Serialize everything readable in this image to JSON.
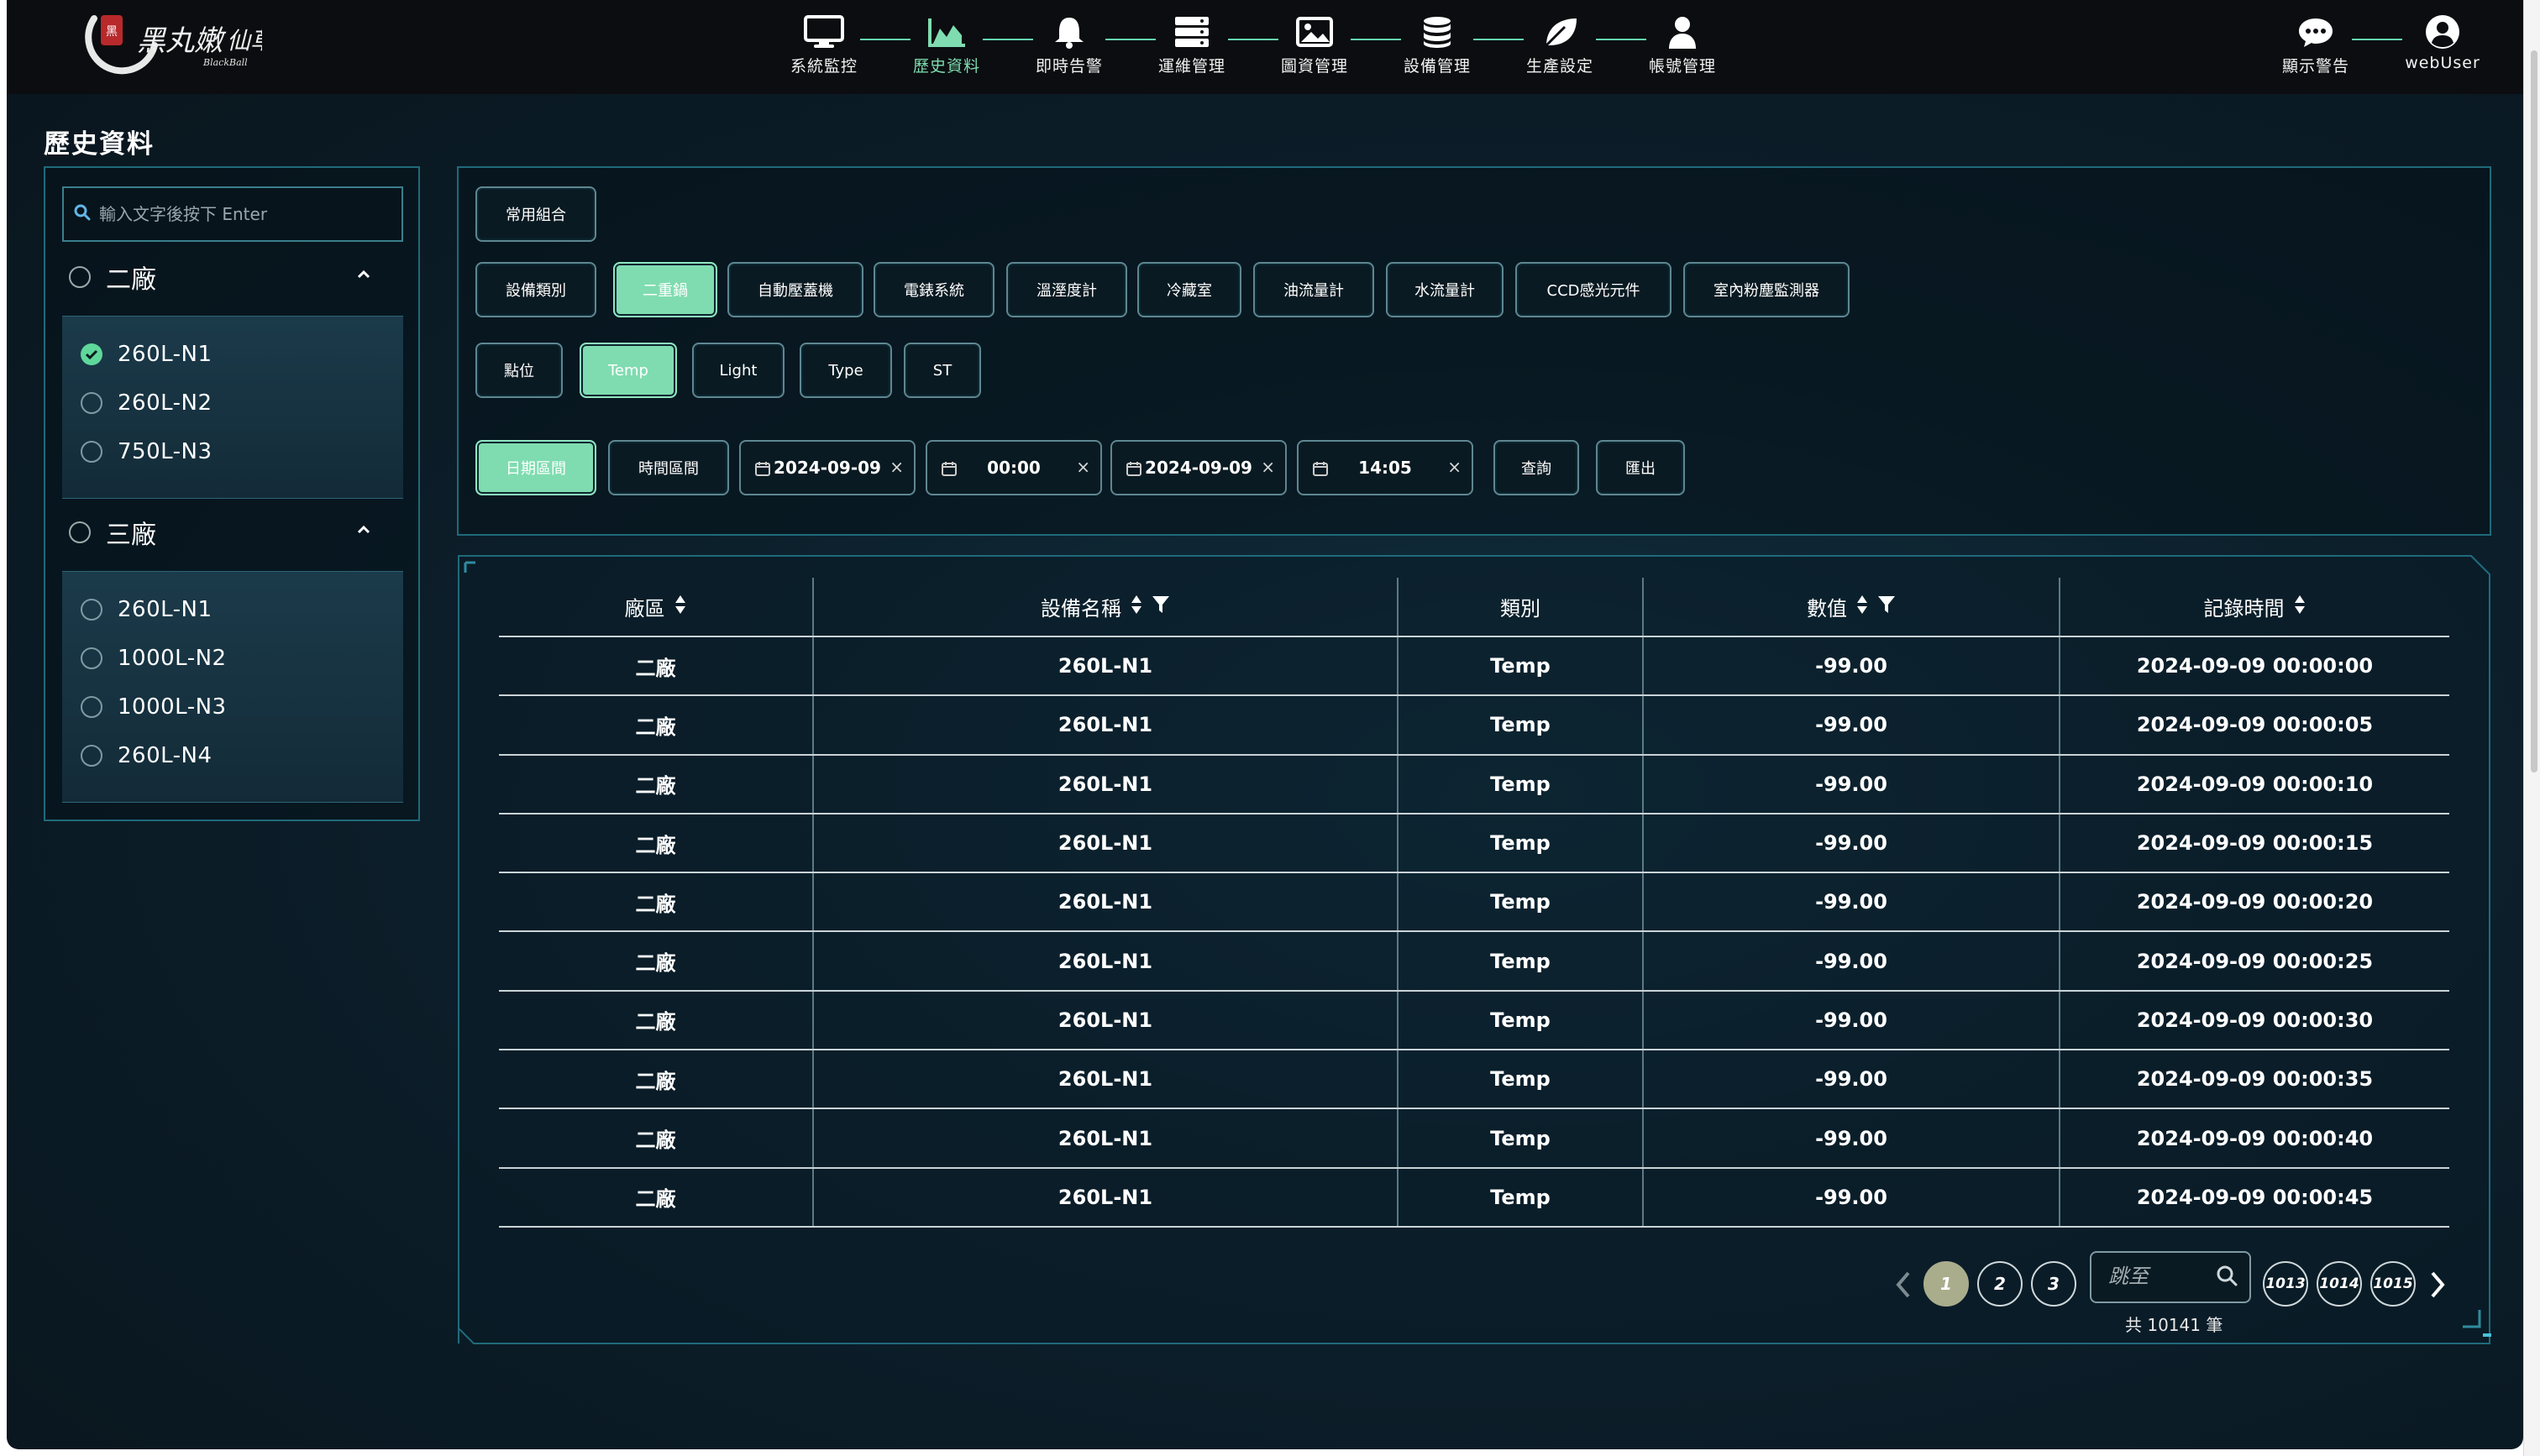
{
  "nav": {
    "items": [
      {
        "label": "系統監控",
        "icon": "monitor-icon",
        "active": false
      },
      {
        "label": "歷史資料",
        "icon": "area-chart-icon",
        "active": true
      },
      {
        "label": "即時告警",
        "icon": "bell-icon",
        "active": false
      },
      {
        "label": "運維管理",
        "icon": "server-icon",
        "active": false
      },
      {
        "label": "圖資管理",
        "icon": "image-icon",
        "active": false
      },
      {
        "label": "設備管理",
        "icon": "database-icon",
        "active": false
      },
      {
        "label": "生產設定",
        "icon": "leaf-icon",
        "active": false
      },
      {
        "label": "帳號管理",
        "icon": "user-icon",
        "active": false
      }
    ],
    "alert_label": "顯示警告",
    "user_label": "webUser",
    "accent": "#7fdcb0"
  },
  "page": {
    "title": "歷史資料"
  },
  "sidebar": {
    "search_placeholder": "輸入文字後按下 Enter",
    "groups": [
      {
        "name": "二廠",
        "expanded": true,
        "items": [
          {
            "label": "260L-N1",
            "checked": true
          },
          {
            "label": "260L-N2",
            "checked": false
          },
          {
            "label": "750L-N3",
            "checked": false
          }
        ]
      },
      {
        "name": "三廠",
        "expanded": true,
        "items": [
          {
            "label": "260L-N1",
            "checked": false
          },
          {
            "label": "1000L-N2",
            "checked": false
          },
          {
            "label": "1000L-N3",
            "checked": false
          },
          {
            "label": "260L-N4",
            "checked": false
          }
        ]
      }
    ]
  },
  "filters": {
    "common_combo_label": "常用組合",
    "device_type_label": "設備類別",
    "device_types": [
      {
        "label": "二重鍋",
        "active": true
      },
      {
        "label": "自動壓蓋機",
        "active": false
      },
      {
        "label": "電錶系統",
        "active": false
      },
      {
        "label": "溫溼度計",
        "active": false
      },
      {
        "label": "冷藏室",
        "active": false
      },
      {
        "label": "油流量計",
        "active": false
      },
      {
        "label": "水流量計",
        "active": false
      },
      {
        "label": "CCD感光元件",
        "active": false
      },
      {
        "label": "室內粉塵監測器",
        "active": false
      }
    ],
    "point_label": "點位",
    "points": [
      {
        "label": "Temp",
        "active": true
      },
      {
        "label": "Light",
        "active": false
      },
      {
        "label": "Type",
        "active": false
      },
      {
        "label": "ST",
        "active": false
      }
    ],
    "date_range_label": "日期區間",
    "time_range_label": "時間區間",
    "start_date": "2024-09-09",
    "start_time": "00:00",
    "end_date": "2024-09-09",
    "end_time": "14:05",
    "query_label": "查詢",
    "export_label": "匯出"
  },
  "table": {
    "columns": [
      "廠區",
      "設備名稱",
      "類別",
      "數值",
      "記錄時間"
    ],
    "rows": [
      [
        "二廠",
        "260L-N1",
        "Temp",
        "-99.00",
        "2024-09-09 00:00:00"
      ],
      [
        "二廠",
        "260L-N1",
        "Temp",
        "-99.00",
        "2024-09-09 00:00:05"
      ],
      [
        "二廠",
        "260L-N1",
        "Temp",
        "-99.00",
        "2024-09-09 00:00:10"
      ],
      [
        "二廠",
        "260L-N1",
        "Temp",
        "-99.00",
        "2024-09-09 00:00:15"
      ],
      [
        "二廠",
        "260L-N1",
        "Temp",
        "-99.00",
        "2024-09-09 00:00:20"
      ],
      [
        "二廠",
        "260L-N1",
        "Temp",
        "-99.00",
        "2024-09-09 00:00:25"
      ],
      [
        "二廠",
        "260L-N1",
        "Temp",
        "-99.00",
        "2024-09-09 00:00:30"
      ],
      [
        "二廠",
        "260L-N1",
        "Temp",
        "-99.00",
        "2024-09-09 00:00:35"
      ],
      [
        "二廠",
        "260L-N1",
        "Temp",
        "-99.00",
        "2024-09-09 00:00:40"
      ],
      [
        "二廠",
        "260L-N1",
        "Temp",
        "-99.00",
        "2024-09-09 00:00:45"
      ]
    ]
  },
  "pagination": {
    "pages_start": [
      "1",
      "2",
      "3"
    ],
    "pages_end": [
      "1013",
      "1014",
      "1015"
    ],
    "current": "1",
    "jump_placeholder": "跳至",
    "total_text": "共 10141 筆"
  }
}
